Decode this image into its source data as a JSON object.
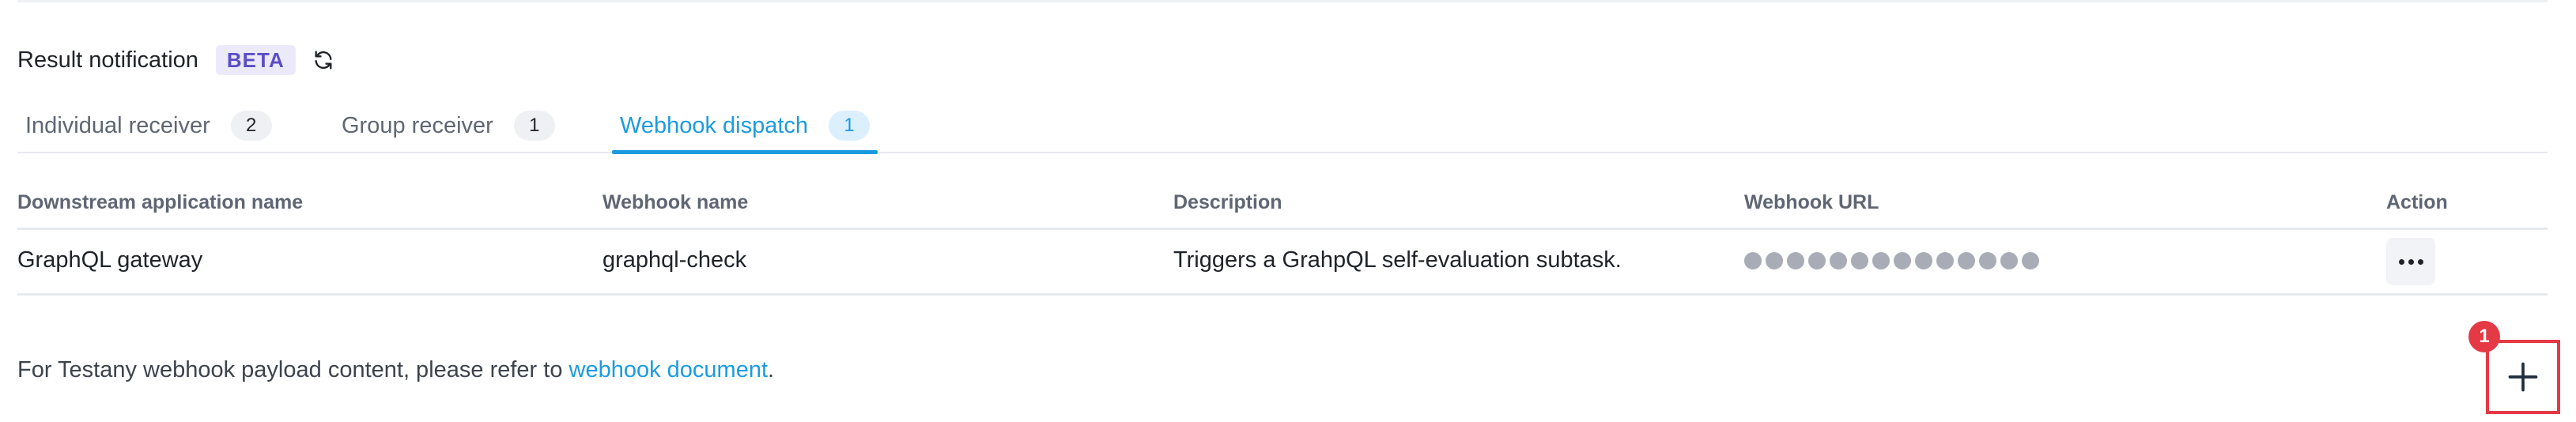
{
  "section": {
    "title": "Result notification",
    "beta_label": "BETA",
    "refresh_icon": "refresh-icon"
  },
  "tabs": [
    {
      "label": "Individual receiver",
      "count": "2",
      "active": false
    },
    {
      "label": "Group receiver",
      "count": "1",
      "active": false
    },
    {
      "label": "Webhook dispatch",
      "count": "1",
      "active": true
    }
  ],
  "table": {
    "headers": [
      "Downstream application name",
      "Webhook name",
      "Description",
      "Webhook URL",
      "Action"
    ],
    "rows": [
      {
        "app_name": "GraphQL gateway",
        "webhook_name": "graphql-check",
        "description": "Triggers a GrahpQL self-evaluation subtask.",
        "webhook_url_masked": true,
        "action_icon": "more-icon"
      }
    ]
  },
  "footer": {
    "text_before": "For Testany webhook payload content, please refer to ",
    "link_text": "webhook document",
    "text_after": "."
  },
  "add_button": {
    "icon": "plus-icon",
    "annotation_number": "1"
  },
  "colors": {
    "accent": "#1a9be0",
    "beta_text": "#5b4fc4",
    "beta_bg": "#eceaf9",
    "highlight_red": "#e53945"
  }
}
